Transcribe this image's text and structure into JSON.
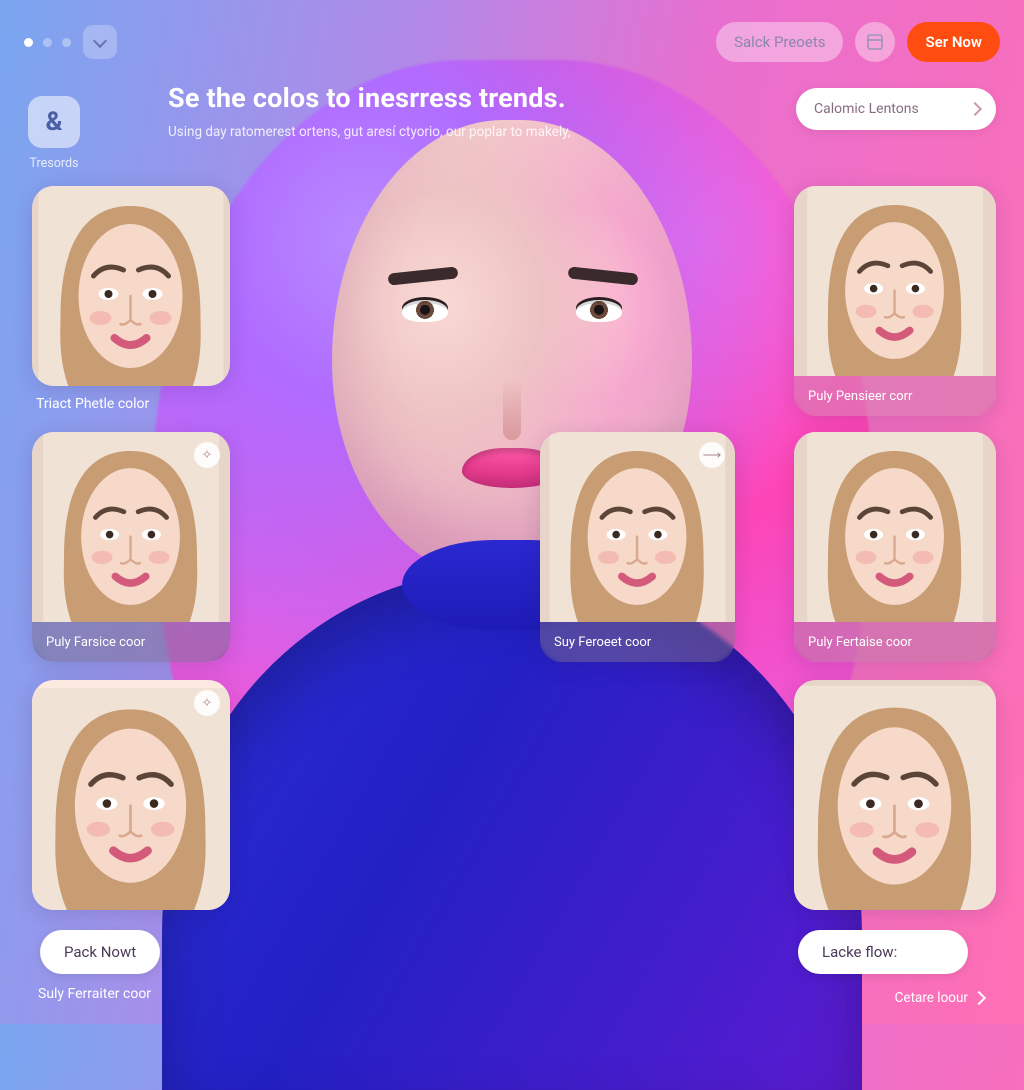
{
  "topbar": {
    "presets_label": "Salck Preoets",
    "cta_label": "Ser Now"
  },
  "heading": {
    "title": "Se the colos to inesrress trends.",
    "subtitle": "Using day ratomerest ortens, gut aresí ctyorio, our poplar to makely,"
  },
  "lens_select": {
    "label": "Calomic Lentons"
  },
  "rail": {
    "glyph": "&",
    "label": "Tresords"
  },
  "left_col": {
    "card1_label": "Triact Phetle color",
    "card2_label": "Puly Farsice coor",
    "card3_button": "Pack Nowt",
    "card3_label": "Suly Ferraiter coor"
  },
  "mid_col": {
    "card1_label": "Suy Feroeet coor"
  },
  "right_col": {
    "card1_label": "Puly Pensieer corr",
    "card2_label": "Puly Fertaise coor",
    "card3_button": "Lacke flow:",
    "footer_label": "Cetare loour"
  }
}
